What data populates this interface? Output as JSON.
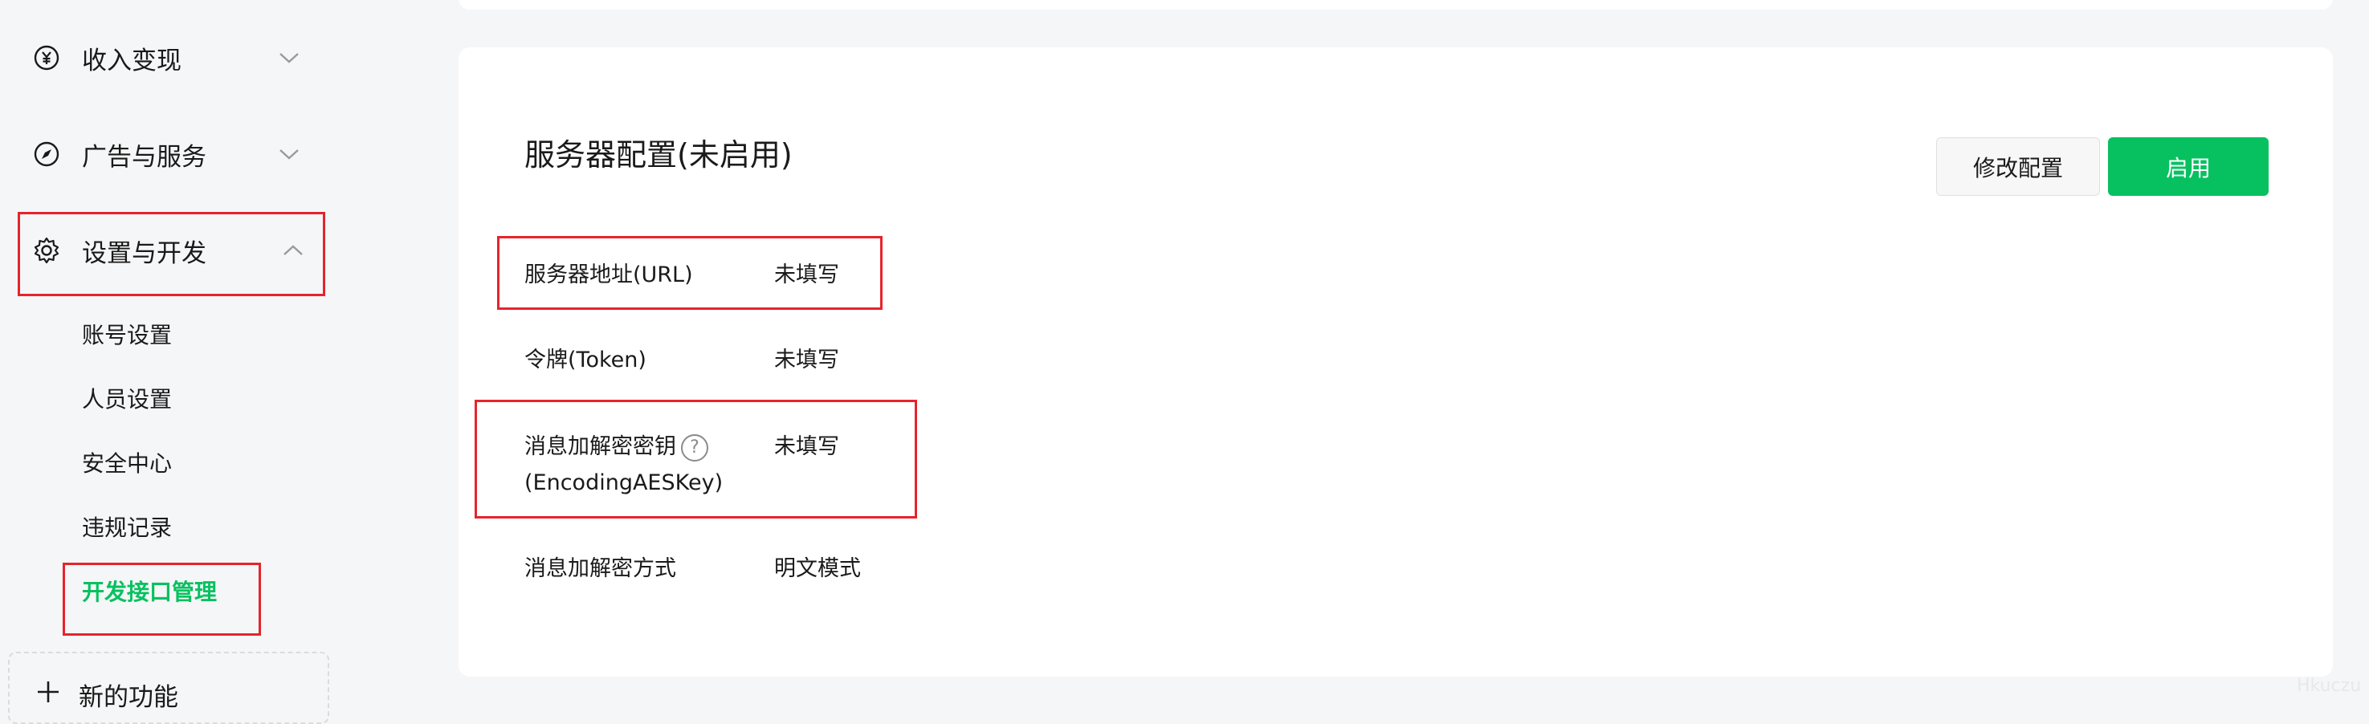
{
  "sidebar": {
    "items": [
      {
        "label": "收入变现",
        "icon": "yen-circle-icon",
        "expanded": false
      },
      {
        "label": "广告与服务",
        "icon": "compass-icon",
        "expanded": false
      },
      {
        "label": "设置与开发",
        "icon": "gear-icon",
        "expanded": true
      }
    ],
    "subitems": [
      {
        "label": "账号设置"
      },
      {
        "label": "人员设置"
      },
      {
        "label": "安全中心"
      },
      {
        "label": "违规记录"
      },
      {
        "label": "开发接口管理",
        "active": true
      }
    ],
    "new_feature": {
      "label": "新的功能",
      "icon": "plus-icon"
    }
  },
  "main": {
    "title": "服务器配置(未启用)",
    "buttons": {
      "modify": "修改配置",
      "enable": "启用"
    },
    "rows": [
      {
        "label": "服务器地址(URL)",
        "value": "未填写"
      },
      {
        "label": "令牌(Token)",
        "value": "未填写"
      },
      {
        "label_line1": "消息加解密密钥",
        "label_line2": "(EncodingAESKey)",
        "value": "未填写",
        "help": "?"
      },
      {
        "label": "消息加解密方式",
        "value": "明文模式"
      }
    ]
  },
  "colors": {
    "accent": "#07c160",
    "highlight_box": "#e6242b",
    "background": "#f5f6f7"
  },
  "watermark": "Hkuczu"
}
